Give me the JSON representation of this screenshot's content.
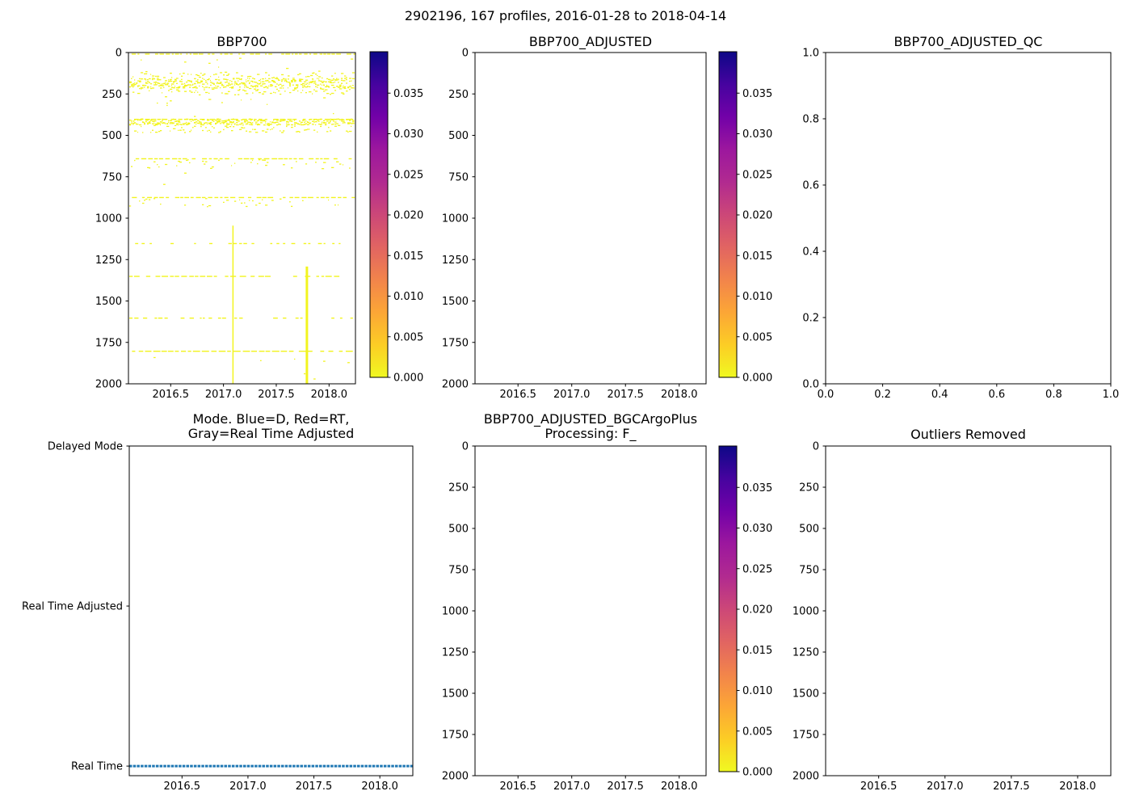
{
  "chart_data": {
    "type": "multi-panel",
    "suptitle": "2902196, 167 profiles, 2016-01-28 to 2018-04-14",
    "colormap": "plasma_r",
    "colormap_stops_top_to_bottom": [
      "#0d0887",
      "#46039f",
      "#7201a8",
      "#9c179e",
      "#b12a90",
      "#cc4778",
      "#e16462",
      "#f2844b",
      "#fca636",
      "#fccd25",
      "#f0f921"
    ],
    "point_color": "#f2f41f",
    "mode_line_color": "#1f77b4",
    "panels": [
      {
        "id": "p1",
        "type": "scatter",
        "title": "BBP700",
        "xlim": [
          2016.1,
          2018.25
        ],
        "ylim": [
          0,
          2000
        ],
        "y_inverted": true,
        "xticks": [
          {
            "v": 2016.5,
            "label": "2016.5"
          },
          {
            "v": 2017.0,
            "label": "2017.0"
          },
          {
            "v": 2017.5,
            "label": "2017.5"
          },
          {
            "v": 2018.0,
            "label": "2018.0"
          }
        ],
        "yticks": [
          {
            "v": 0,
            "label": "0"
          },
          {
            "v": 250,
            "label": "250"
          },
          {
            "v": 500,
            "label": "500"
          },
          {
            "v": 750,
            "label": "750"
          },
          {
            "v": 1000,
            "label": "1000"
          },
          {
            "v": 1250,
            "label": "1250"
          },
          {
            "v": 1500,
            "label": "1500"
          },
          {
            "v": 1750,
            "label": "1750"
          },
          {
            "v": 2000,
            "label": "2000"
          }
        ],
        "features": [
          {
            "kind": "hline",
            "depth": 6,
            "density": 0.82,
            "wmin": 2,
            "wmax": 6
          },
          {
            "kind": "band",
            "d0": 30,
            "d1": 118,
            "density": 0.07
          },
          {
            "kind": "band",
            "d0": 118,
            "d1": 155,
            "density": 0.5
          },
          {
            "kind": "band",
            "d0": 152,
            "d1": 212,
            "density": 0.95,
            "dense": true
          },
          {
            "kind": "band",
            "d0": 210,
            "d1": 250,
            "density": 0.5
          },
          {
            "kind": "band",
            "d0": 250,
            "d1": 312,
            "density": 0.07
          },
          {
            "kind": "band",
            "d0": 315,
            "d1": 390,
            "density": 0.015
          },
          {
            "kind": "hline",
            "depth": 400,
            "density": 0.7,
            "wmin": 3,
            "wmax": 7
          },
          {
            "kind": "band",
            "d0": 398,
            "d1": 435,
            "density": 0.8,
            "dense": true
          },
          {
            "kind": "band",
            "d0": 435,
            "d1": 480,
            "density": 0.5
          },
          {
            "kind": "band",
            "d0": 482,
            "d1": 560,
            "density": 0.012
          },
          {
            "kind": "hline",
            "depth": 638,
            "density": 0.72,
            "wmin": 3,
            "wmax": 7
          },
          {
            "kind": "band",
            "d0": 642,
            "d1": 700,
            "density": 0.3
          },
          {
            "kind": "band",
            "d0": 705,
            "d1": 800,
            "density": 0.018
          },
          {
            "kind": "hline",
            "depth": 872,
            "density": 0.75,
            "wmin": 3,
            "wmax": 7
          },
          {
            "kind": "band",
            "d0": 876,
            "d1": 928,
            "density": 0.3
          },
          {
            "kind": "band",
            "d0": 940,
            "d1": 1130,
            "density": 0.012
          },
          {
            "kind": "hline",
            "depth": 1150,
            "density": 0.28,
            "wmin": 2,
            "wmax": 5
          },
          {
            "kind": "hline",
            "depth": 1348,
            "density": 0.5,
            "wmin": 3,
            "wmax": 8
          },
          {
            "kind": "hline",
            "depth": 1600,
            "density": 0.33,
            "wmin": 2,
            "wmax": 6
          },
          {
            "kind": "hline",
            "depth": 1800,
            "density": 0.85,
            "wmin": 4,
            "wmax": 10
          },
          {
            "kind": "band",
            "d0": 1825,
            "d1": 1875,
            "density": 0.05
          },
          {
            "kind": "band",
            "d0": 1880,
            "d1": 2000,
            "density": 0.006
          },
          {
            "kind": "vline",
            "t": 2017.09,
            "d0": 1045,
            "d1": 2000,
            "w": 1.5
          },
          {
            "kind": "vline",
            "t": 2017.79,
            "d0": 1292,
            "d1": 2000,
            "w": 3
          }
        ]
      },
      {
        "id": "p2",
        "type": "scatter",
        "title": "BBP700_ADJUSTED",
        "xlim": [
          2016.1,
          2018.25
        ],
        "ylim": [
          0,
          2000
        ],
        "y_inverted": true,
        "xticks": [
          {
            "v": 2016.5,
            "label": "2016.5"
          },
          {
            "v": 2017.0,
            "label": "2017.0"
          },
          {
            "v": 2017.5,
            "label": "2017.5"
          },
          {
            "v": 2018.0,
            "label": "2018.0"
          }
        ],
        "yticks": [
          {
            "v": 0,
            "label": "0"
          },
          {
            "v": 250,
            "label": "250"
          },
          {
            "v": 500,
            "label": "500"
          },
          {
            "v": 750,
            "label": "750"
          },
          {
            "v": 1000,
            "label": "1000"
          },
          {
            "v": 1250,
            "label": "1250"
          },
          {
            "v": 1500,
            "label": "1500"
          },
          {
            "v": 1750,
            "label": "1750"
          },
          {
            "v": 2000,
            "label": "2000"
          }
        ],
        "features": []
      },
      {
        "id": "p3",
        "type": "scatter",
        "title": "BBP700_ADJUSTED_QC",
        "xlim": [
          0,
          1
        ],
        "ylim": [
          0,
          1
        ],
        "y_inverted": false,
        "xticks": [
          {
            "v": 0.0,
            "label": "0.0"
          },
          {
            "v": 0.2,
            "label": "0.2"
          },
          {
            "v": 0.4,
            "label": "0.4"
          },
          {
            "v": 0.6,
            "label": "0.6"
          },
          {
            "v": 0.8,
            "label": "0.8"
          },
          {
            "v": 1.0,
            "label": "1.0"
          }
        ],
        "yticks": [
          {
            "v": 0.0,
            "label": "0.0"
          },
          {
            "v": 0.2,
            "label": "0.2"
          },
          {
            "v": 0.4,
            "label": "0.4"
          },
          {
            "v": 0.6,
            "label": "0.6"
          },
          {
            "v": 0.8,
            "label": "0.8"
          },
          {
            "v": 1.0,
            "label": "1.0"
          }
        ],
        "features": []
      },
      {
        "id": "p4",
        "type": "line",
        "title": "Mode. Blue=D, Red=RT,\nGray=Real Time Adjusted",
        "xlim": [
          2016.1,
          2018.25
        ],
        "ylim": [
          -0.06,
          2.0
        ],
        "y_inverted": false,
        "xticks": [
          {
            "v": 2016.5,
            "label": "2016.5"
          },
          {
            "v": 2017.0,
            "label": "2017.0"
          },
          {
            "v": 2017.5,
            "label": "2017.5"
          },
          {
            "v": 2018.0,
            "label": "2018.0"
          }
        ],
        "yticks": [
          {
            "v": 2,
            "label": "Delayed Mode"
          },
          {
            "v": 1,
            "label": "Real Time Adjusted"
          },
          {
            "v": 0,
            "label": "Real Time"
          }
        ],
        "series": [
          {
            "name": "mode-real-time",
            "note": "all 167 profiles are Real Time mode",
            "color": "#1f77b4",
            "y": 0,
            "x0": 2016.1,
            "x1": 2018.25,
            "width": 3,
            "dash": "3.5 1.2"
          }
        ],
        "features": []
      },
      {
        "id": "p5",
        "type": "scatter",
        "title": "BBP700_ADJUSTED_BGCArgoPlus\nProcessing: F_",
        "xlim": [
          2016.1,
          2018.25
        ],
        "ylim": [
          0,
          2000
        ],
        "y_inverted": true,
        "xticks": [
          {
            "v": 2016.5,
            "label": "2016.5"
          },
          {
            "v": 2017.0,
            "label": "2017.0"
          },
          {
            "v": 2017.5,
            "label": "2017.5"
          },
          {
            "v": 2018.0,
            "label": "2018.0"
          }
        ],
        "yticks": [
          {
            "v": 0,
            "label": "0"
          },
          {
            "v": 250,
            "label": "250"
          },
          {
            "v": 500,
            "label": "500"
          },
          {
            "v": 750,
            "label": "750"
          },
          {
            "v": 1000,
            "label": "1000"
          },
          {
            "v": 1250,
            "label": "1250"
          },
          {
            "v": 1500,
            "label": "1500"
          },
          {
            "v": 1750,
            "label": "1750"
          },
          {
            "v": 2000,
            "label": "2000"
          }
        ],
        "features": []
      },
      {
        "id": "p6",
        "type": "scatter",
        "title": "Outliers Removed",
        "xlim": [
          2016.1,
          2018.25
        ],
        "ylim": [
          0,
          2000
        ],
        "y_inverted": true,
        "xticks": [
          {
            "v": 2016.5,
            "label": "2016.5"
          },
          {
            "v": 2017.0,
            "label": "2017.0"
          },
          {
            "v": 2017.5,
            "label": "2017.5"
          },
          {
            "v": 2018.0,
            "label": "2018.0"
          }
        ],
        "yticks": [
          {
            "v": 0,
            "label": "0"
          },
          {
            "v": 250,
            "label": "250"
          },
          {
            "v": 500,
            "label": "500"
          },
          {
            "v": 750,
            "label": "750"
          },
          {
            "v": 1000,
            "label": "1000"
          },
          {
            "v": 1250,
            "label": "1250"
          },
          {
            "v": 1500,
            "label": "1500"
          },
          {
            "v": 1750,
            "label": "1750"
          },
          {
            "v": 2000,
            "label": "2000"
          }
        ],
        "features": []
      }
    ],
    "colorbars": [
      {
        "id": "cb1",
        "vmin": 0,
        "vmax": 0.0401,
        "ticks": [
          {
            "v": 0.0,
            "label": "0.000"
          },
          {
            "v": 0.005,
            "label": "0.005"
          },
          {
            "v": 0.01,
            "label": "0.010"
          },
          {
            "v": 0.015,
            "label": "0.015"
          },
          {
            "v": 0.02,
            "label": "0.020"
          },
          {
            "v": 0.025,
            "label": "0.025"
          },
          {
            "v": 0.03,
            "label": "0.030"
          },
          {
            "v": 0.035,
            "label": "0.035"
          }
        ]
      },
      {
        "id": "cb2",
        "vmin": 0,
        "vmax": 0.0401,
        "ticks": [
          {
            "v": 0.0,
            "label": "0.000"
          },
          {
            "v": 0.005,
            "label": "0.005"
          },
          {
            "v": 0.01,
            "label": "0.010"
          },
          {
            "v": 0.015,
            "label": "0.015"
          },
          {
            "v": 0.02,
            "label": "0.020"
          },
          {
            "v": 0.025,
            "label": "0.025"
          },
          {
            "v": 0.03,
            "label": "0.030"
          },
          {
            "v": 0.035,
            "label": "0.035"
          }
        ]
      },
      {
        "id": "cb3",
        "vmin": 0,
        "vmax": 0.0401,
        "ticks": [
          {
            "v": 0.0,
            "label": "0.000"
          },
          {
            "v": 0.005,
            "label": "0.005"
          },
          {
            "v": 0.01,
            "label": "0.010"
          },
          {
            "v": 0.015,
            "label": "0.015"
          },
          {
            "v": 0.02,
            "label": "0.020"
          },
          {
            "v": 0.025,
            "label": "0.025"
          },
          {
            "v": 0.03,
            "label": "0.030"
          },
          {
            "v": 0.035,
            "label": "0.035"
          }
        ]
      }
    ]
  }
}
